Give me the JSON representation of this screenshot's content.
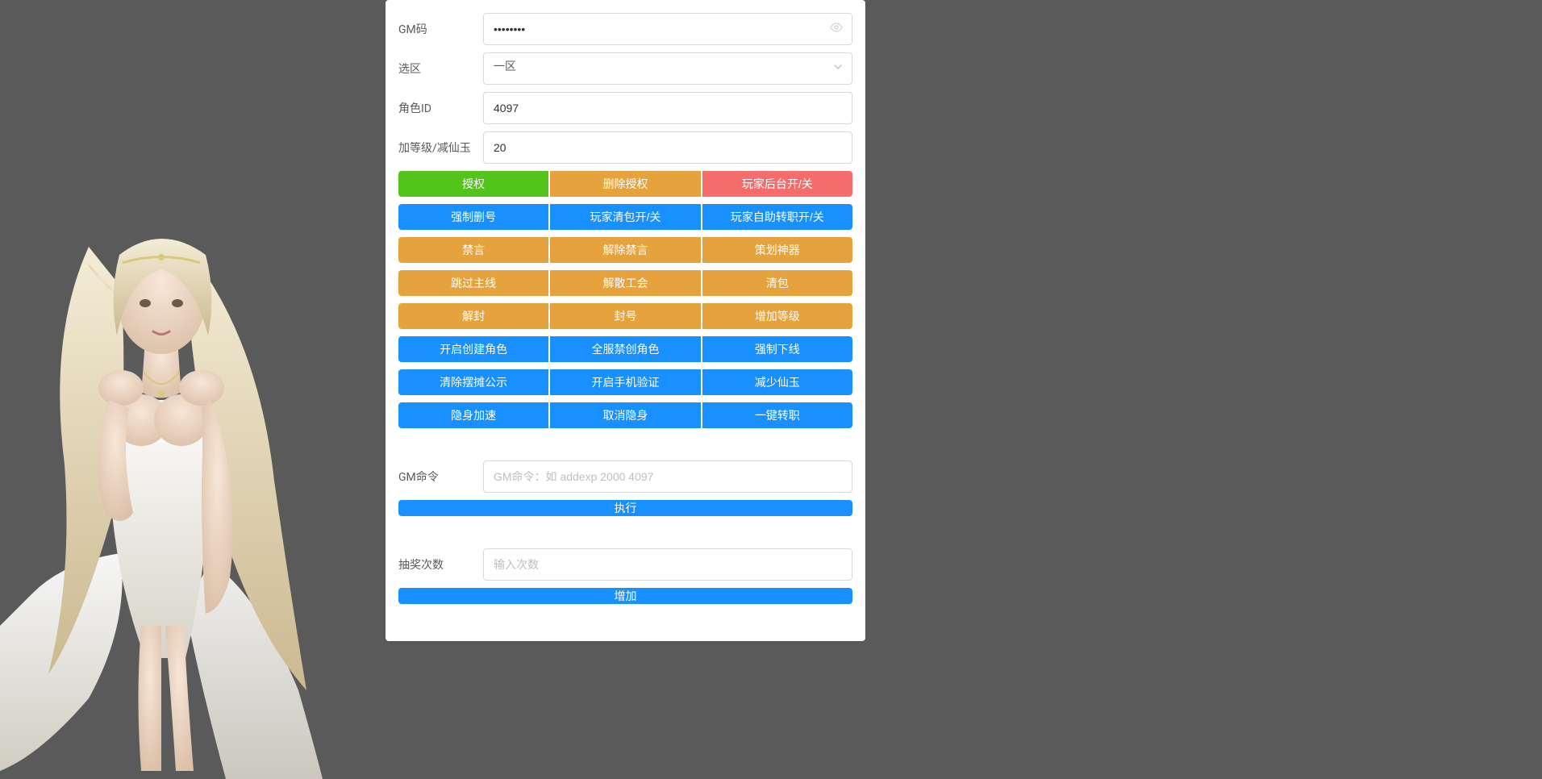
{
  "fields": {
    "gm_code": {
      "label": "GM码",
      "value": "••••••••"
    },
    "zone": {
      "label": "选区",
      "selected": "一区"
    },
    "role_id": {
      "label": "角色ID",
      "value": "4097"
    },
    "level": {
      "label": "加等级/减仙玉",
      "value": "20"
    },
    "gm_cmd": {
      "label": "GM命令",
      "placeholder": "GM命令：如 addexp 2000 4097"
    },
    "lottery": {
      "label": "抽奖次数",
      "placeholder": "输入次数"
    }
  },
  "buttonRows": [
    {
      "buttons": [
        {
          "label": "授权",
          "color": "green"
        },
        {
          "label": "删除授权",
          "color": "orange"
        },
        {
          "label": "玩家后台开/关",
          "color": "red"
        }
      ]
    },
    {
      "buttons": [
        {
          "label": "强制删号",
          "color": "blue"
        },
        {
          "label": "玩家清包开/关",
          "color": "blue"
        },
        {
          "label": "玩家自助转职开/关",
          "color": "blue"
        }
      ]
    },
    {
      "buttons": [
        {
          "label": "禁言",
          "color": "orange"
        },
        {
          "label": "解除禁言",
          "color": "orange"
        },
        {
          "label": "策划神器",
          "color": "orange"
        }
      ]
    },
    {
      "buttons": [
        {
          "label": "跳过主线",
          "color": "orange"
        },
        {
          "label": "解散工会",
          "color": "orange"
        },
        {
          "label": "清包",
          "color": "orange"
        }
      ]
    },
    {
      "buttons": [
        {
          "label": "解封",
          "color": "orange"
        },
        {
          "label": "封号",
          "color": "orange"
        },
        {
          "label": "增加等级",
          "color": "orange"
        }
      ]
    },
    {
      "buttons": [
        {
          "label": "开启创建角色",
          "color": "blue"
        },
        {
          "label": "全服禁创角色",
          "color": "blue"
        },
        {
          "label": "强制下线",
          "color": "blue"
        }
      ]
    },
    {
      "buttons": [
        {
          "label": "清除摆摊公示",
          "color": "blue"
        },
        {
          "label": "开启手机验证",
          "color": "blue"
        },
        {
          "label": "减少仙玉",
          "color": "blue"
        }
      ]
    },
    {
      "buttons": [
        {
          "label": "隐身加速",
          "color": "blue"
        },
        {
          "label": "取消隐身",
          "color": "blue"
        },
        {
          "label": "一键转职",
          "color": "blue"
        }
      ]
    }
  ],
  "actions": {
    "execute": "执行",
    "increase": "增加"
  },
  "colors": {
    "green": "#52c41a",
    "orange": "#e6a23c",
    "red": "#f56c6c",
    "blue": "#1890ff"
  }
}
